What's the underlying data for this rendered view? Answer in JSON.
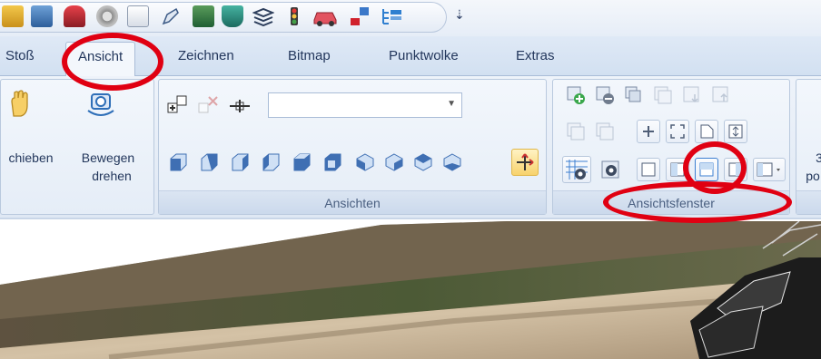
{
  "tabs": [
    {
      "label": "Stoß",
      "active": false
    },
    {
      "label": "Ansicht",
      "active": true
    },
    {
      "label": "Zeichnen",
      "active": false
    },
    {
      "label": "Bitmap",
      "active": false
    },
    {
      "label": "Punktwolke",
      "active": false
    },
    {
      "label": "Extras",
      "active": false
    }
  ],
  "quick_access": {
    "icons": [
      "eye-folder-icon",
      "open-folder-icon",
      "car-icon",
      "wheel-icon",
      "document-icon",
      "pen-icon",
      "camera-icon",
      "camera-bowl-icon",
      "layers-icon",
      "traffic-light-icon",
      "red-car-icon",
      "flag-icon",
      "tree-list-icon"
    ],
    "more": "⇣"
  },
  "groups": {
    "navigate": {
      "label1": "chieben",
      "label2_line1": "Bewegen",
      "label2_line2": "drehen"
    },
    "ansichten": {
      "label": "Ansichten",
      "combo_value": ""
    },
    "ansichtsfenster": {
      "label": "Ansichtsfenster"
    },
    "extra": {
      "label_line1": "3",
      "label_line2": "po"
    }
  },
  "colors": {
    "highlight_red": "#e00012",
    "ribbon_bg": "#e5edf7",
    "accent_blue": "#3d7fd1",
    "cube_blue": "#3f6fb3"
  }
}
